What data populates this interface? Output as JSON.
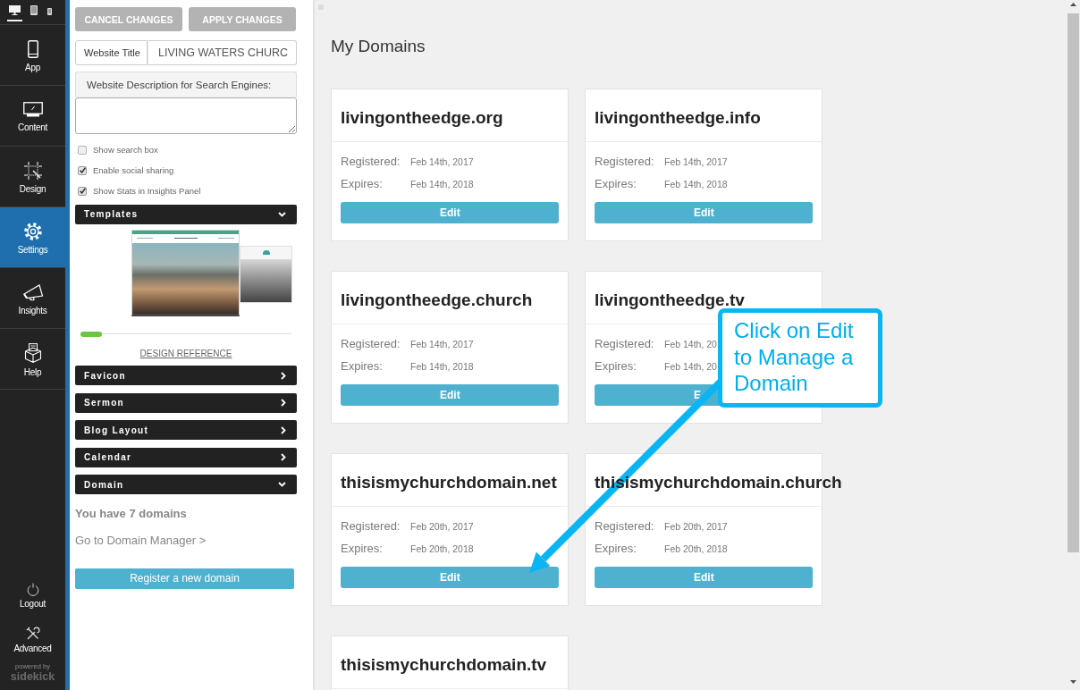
{
  "nav": {
    "devices": [
      {
        "kind": "desktop",
        "selected": true
      },
      {
        "kind": "tablet",
        "selected": false
      },
      {
        "kind": "phone",
        "selected": false
      }
    ],
    "items": [
      {
        "kind": "app",
        "label": "App",
        "selected": false
      },
      {
        "kind": "content",
        "label": "Content",
        "selected": false
      },
      {
        "kind": "design",
        "label": "Design",
        "selected": false
      },
      {
        "kind": "settings",
        "label": "Settings",
        "selected": true
      },
      {
        "kind": "insights",
        "label": "Insights",
        "selected": false
      },
      {
        "kind": "help",
        "label": "Help",
        "selected": false
      }
    ],
    "footer_items": [
      {
        "kind": "logout",
        "label": "Logout"
      },
      {
        "kind": "advanced",
        "label": "Advanced"
      }
    ],
    "brand": {
      "tagline": "powered by",
      "name": "sidekick"
    }
  },
  "panel": {
    "buttons": [
      "CANCEL CHANGES",
      "APPLY CHANGES"
    ],
    "title_field": {
      "label": "Website Title",
      "value": "LIVING WATERS CHURC"
    },
    "description_field": {
      "label": "Website Description for Search Engines:"
    },
    "checkboxes": [
      {
        "label": "Show search box",
        "checked": false
      },
      {
        "label": "Enable social sharing",
        "checked": true
      },
      {
        "label": "Show Stats in Insights Panel",
        "checked": true
      }
    ],
    "sections": [
      {
        "label": "Templates",
        "expanded": true,
        "content": {
          "kind": "templates",
          "link": "DESIGN REFERENCE"
        }
      },
      {
        "label": "Favicon",
        "expanded": false
      },
      {
        "label": "Sermon",
        "expanded": false
      },
      {
        "label": "Blog Layout",
        "expanded": false
      },
      {
        "label": "Calendar",
        "expanded": false
      },
      {
        "label": "Domain",
        "expanded": true,
        "content": {
          "kind": "domain",
          "summary": "You have 7 domains",
          "link": "Go to Domain Manager >",
          "button": "Register a new domain"
        }
      }
    ]
  },
  "main": {
    "title": "My Domains",
    "domains": [
      {
        "name": "livingontheedge.org",
        "rows": [
          {
            "label": "Registered:",
            "value": "Feb 14th, 2017"
          },
          {
            "label": "Expires:",
            "value": "Feb 14th, 2018"
          }
        ],
        "button": "Edit"
      },
      {
        "name": "livingontheedge.info",
        "rows": [
          {
            "label": "Registered:",
            "value": "Feb 14th, 2017"
          },
          {
            "label": "Expires:",
            "value": "Feb 14th, 2018"
          }
        ],
        "button": "Edit"
      },
      {
        "name": "livingontheedge.church",
        "rows": [
          {
            "label": "Registered:",
            "value": "Feb 14th, 2017"
          },
          {
            "label": "Expires:",
            "value": "Feb 14th, 2018"
          }
        ],
        "button": "Edit"
      },
      {
        "name": "livingontheedge.tv",
        "rows": [
          {
            "label": "Registered:",
            "value": "Feb 14th, 20"
          },
          {
            "label": "Expires:",
            "value": "Feb 14th, 20"
          }
        ],
        "button": "E"
      },
      {
        "name": "thisismychurchdomain.net",
        "rows": [
          {
            "label": "Registered:",
            "value": "Feb 20th, 2017"
          },
          {
            "label": "Expires:",
            "value": "Feb 20th, 2018"
          }
        ],
        "button": "Edit"
      },
      {
        "name": "thisismychurchdomain.church",
        "rows": [
          {
            "label": "Registered:",
            "value": "Feb 20th, 2017"
          },
          {
            "label": "Expires:",
            "value": "Feb 20th, 2018"
          }
        ],
        "button": "Edit"
      },
      {
        "name": "thisismychurchdomain.tv"
      }
    ]
  },
  "callout": {
    "text": "Click on Edit to Manage a Domain"
  }
}
